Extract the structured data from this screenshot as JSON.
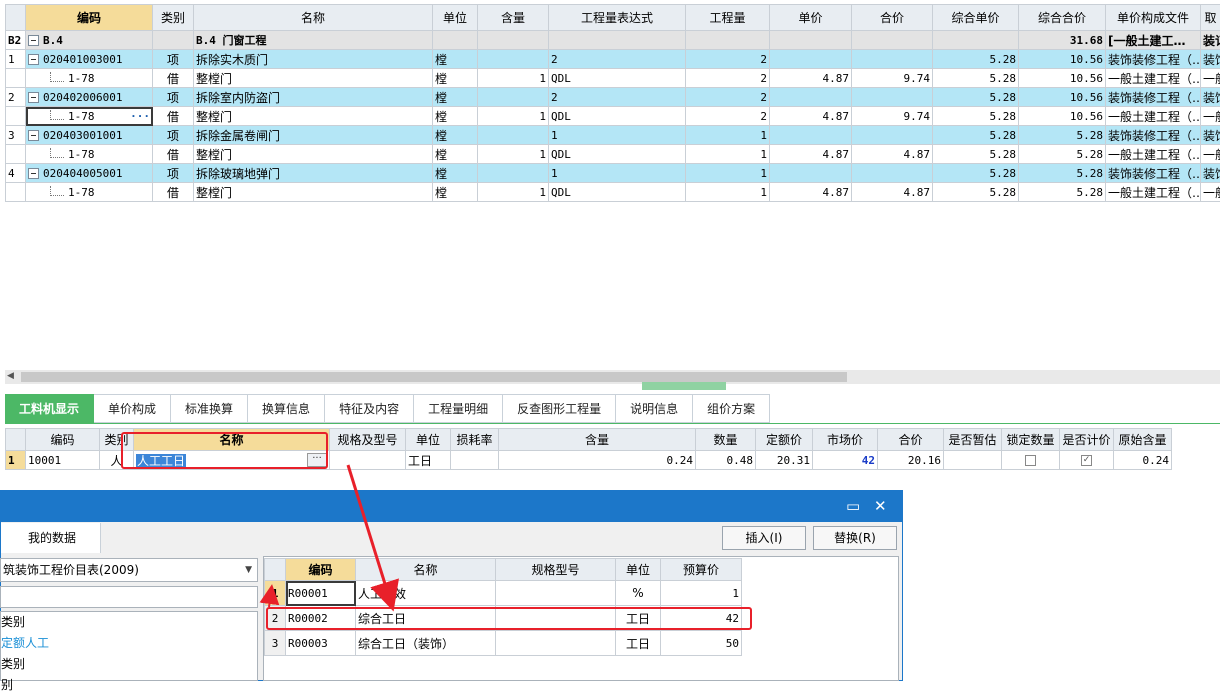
{
  "main_grid": {
    "columns": [
      "编码",
      "类别",
      "名称",
      "单位",
      "含量",
      "工程量表达式",
      "工程量",
      "单价",
      "合价",
      "综合单价",
      "综合合价",
      "单价构成文件",
      "取"
    ],
    "section": {
      "rowno": "B2",
      "code": "B.4",
      "name": "B.4  门窗工程",
      "total": "31.68",
      "file": "[一般土建工…",
      "extra": "装订"
    },
    "rows": [
      {
        "rowno": "1",
        "code": "020401003001",
        "type": "项",
        "name": "拆除实木质门",
        "unit": "樘",
        "qty_expr": "2",
        "qty": "2",
        "comp_price": "5.28",
        "comp_total": "10.56",
        "file": "装饰装修工程（…",
        "extra": "装饰"
      },
      {
        "rowno": "",
        "code": "1-78",
        "type": "借",
        "name": "整樘门",
        "unit": "樘",
        "content": "1",
        "qty_expr": "QDL",
        "qty": "2",
        "price": "4.87",
        "total": "9.74",
        "comp_price": "5.28",
        "comp_total": "10.56",
        "file": "一般土建工程（…",
        "extra": "一般"
      },
      {
        "rowno": "2",
        "code": "020402006001",
        "type": "项",
        "name": "拆除室内防盗门",
        "unit": "樘",
        "qty_expr": "2",
        "qty": "2",
        "comp_price": "5.28",
        "comp_total": "10.56",
        "file": "装饰装修工程（…",
        "extra": "装饰"
      },
      {
        "rowno": "",
        "code": "1-78",
        "type": "借",
        "name": "整樘门",
        "unit": "樘",
        "content": "1",
        "qty_expr": "QDL",
        "qty": "2",
        "price": "4.87",
        "total": "9.74",
        "comp_price": "5.28",
        "comp_total": "10.56",
        "file": "一般土建工程（…",
        "extra": "一般"
      },
      {
        "rowno": "3",
        "code": "020403001001",
        "type": "项",
        "name": "拆除金属卷闸门",
        "unit": "樘",
        "qty_expr": "1",
        "qty": "1",
        "comp_price": "5.28",
        "comp_total": "5.28",
        "file": "装饰装修工程（…",
        "extra": "装饰"
      },
      {
        "rowno": "",
        "code": "1-78",
        "type": "借",
        "name": "整樘门",
        "unit": "樘",
        "content": "1",
        "qty_expr": "QDL",
        "qty": "1",
        "price": "4.87",
        "total": "4.87",
        "comp_price": "5.28",
        "comp_total": "5.28",
        "file": "一般土建工程（…",
        "extra": "一般"
      },
      {
        "rowno": "4",
        "code": "020404005001",
        "type": "项",
        "name": "拆除玻璃地弹门",
        "unit": "樘",
        "qty_expr": "1",
        "qty": "1",
        "comp_price": "5.28",
        "comp_total": "5.28",
        "file": "装饰装修工程（…",
        "extra": "装饰"
      },
      {
        "rowno": "",
        "code": "1-78",
        "type": "借",
        "name": "整樘门",
        "unit": "樘",
        "content": "1",
        "qty_expr": "QDL",
        "qty": "1",
        "price": "4.87",
        "total": "4.87",
        "comp_price": "5.28",
        "comp_total": "5.28",
        "file": "一般土建工程（…",
        "extra": "一般"
      }
    ],
    "dots": "···"
  },
  "tabs": [
    "工料机显示",
    "单价构成",
    "标准换算",
    "换算信息",
    "特征及内容",
    "工程量明细",
    "反查图形工程量",
    "说明信息",
    "组价方案"
  ],
  "resource_grid": {
    "columns": [
      "编码",
      "类别",
      "名称",
      "规格及型号",
      "单位",
      "损耗率",
      "含量",
      "数量",
      "定额价",
      "市场价",
      "合价",
      "是否暂估",
      "锁定数量",
      "是否计价",
      "原始含量"
    ],
    "row": {
      "rowno": "1",
      "code": "10001",
      "type": "人",
      "name": "人工工日",
      "spec": "",
      "unit": "工日",
      "loss": "",
      "content": "0.24",
      "quantity": "0.48",
      "quota_price": "20.31",
      "market_price": "42",
      "total": "20.16",
      "estimated": false,
      "lock_qty": false,
      "priced": true,
      "orig_content": "0.24"
    },
    "edit_btn": "···"
  },
  "dialog": {
    "tab": "我的数据",
    "insert_btn": "插入(I)",
    "replace_btn": "替换(R)",
    "library": "筑装饰工程价目表(2009)",
    "categories": [
      "类别",
      "定额人工",
      "类别",
      "别"
    ],
    "columns": [
      "编码",
      "名称",
      "规格型号",
      "单位",
      "预算价"
    ],
    "rows": [
      {
        "rowno": "1",
        "code": "R00001",
        "name": "人工费效",
        "spec": "",
        "unit": "%",
        "price": "1"
      },
      {
        "rowno": "2",
        "code": "R00002",
        "name": "综合工日",
        "spec": "",
        "unit": "工日",
        "price": "42"
      },
      {
        "rowno": "3",
        "code": "R00003",
        "name": "综合工日（装饰）",
        "spec": "",
        "unit": "工日",
        "price": "50"
      }
    ]
  },
  "colors": {
    "accent_green": "#4cb866",
    "title_blue": "#1c77c9",
    "item_row": "#b4e6f6",
    "annotation_red": "#e8202a"
  }
}
